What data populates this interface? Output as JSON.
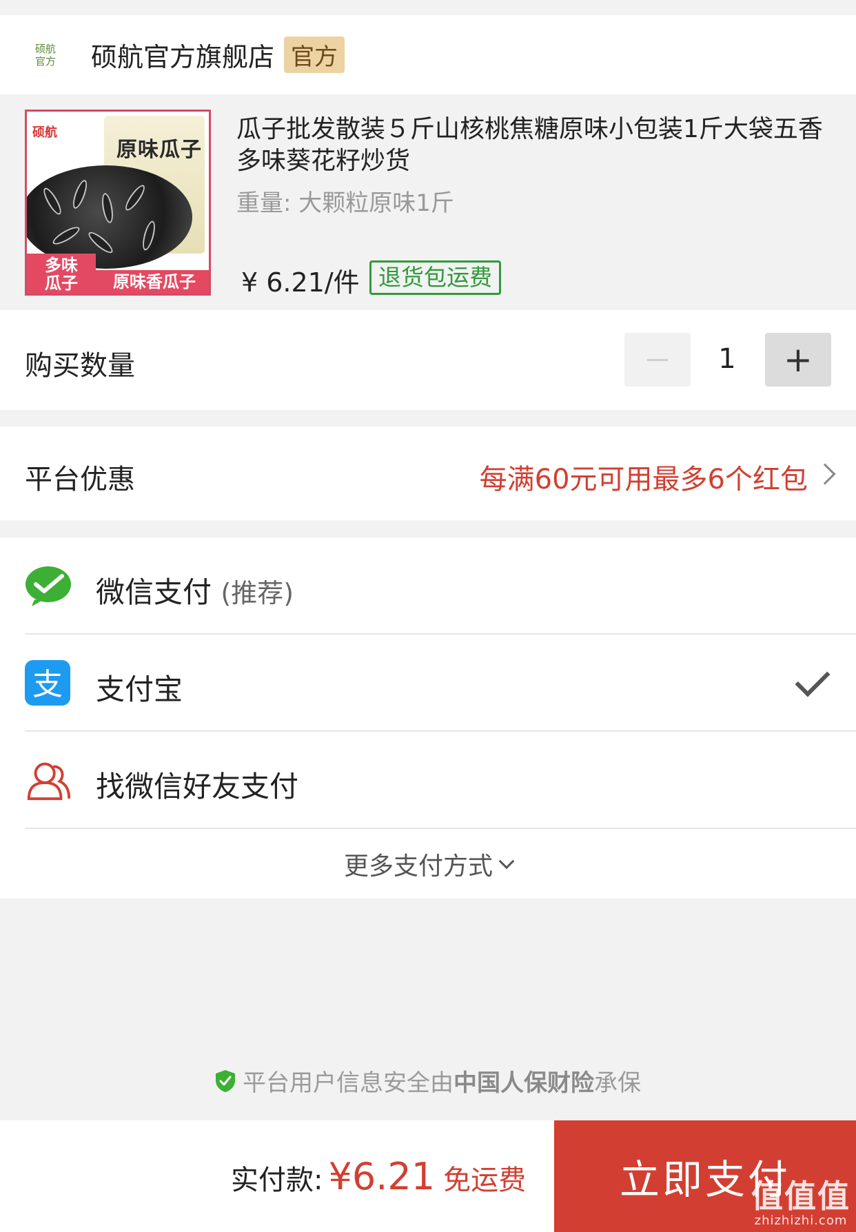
{
  "store": {
    "logo_line1": "硕航",
    "logo_line2": "官方",
    "name": "硕航官方旗舰店",
    "badge": "官方"
  },
  "product": {
    "image": {
      "brand": "硕航",
      "bag_title": "原味瓜子",
      "tag_left_line1": "多味",
      "tag_left_line2": "瓜子",
      "tag_right": "原味香瓜子"
    },
    "title": "瓜子批发散装５斤山核桃焦糖原味小包装1斤大袋五香多味葵花籽炒货",
    "spec": "重量: 大颗粒原味1斤",
    "price": "¥ 6.21/件",
    "return_badge": "退货包运费"
  },
  "quantity": {
    "label": "购买数量",
    "value": "1",
    "minus": "−",
    "plus": "+"
  },
  "promo": {
    "label": "平台优惠",
    "value": "每满60元可用最多6个红包"
  },
  "payment": {
    "methods": [
      {
        "label": "微信支付",
        "sub": "(推荐)",
        "icon": "wechat-pay-icon",
        "selected": false
      },
      {
        "label": "支付宝",
        "sub": "",
        "icon": "alipay-icon",
        "selected": true
      },
      {
        "label": "找微信好友支付",
        "sub": "",
        "icon": "friend-pay-icon",
        "selected": false
      }
    ],
    "more": "更多支付方式"
  },
  "security": {
    "prefix": "平台用户信息安全由",
    "insurer": "中国人保财险",
    "suffix": "承保"
  },
  "bottom": {
    "amount_label": "实付款:",
    "amount": "¥6.21",
    "free_shipping": "免运费",
    "pay_button": "立即支付"
  },
  "watermark": {
    "text": "值值值",
    "url": "zhizhizhi.com"
  },
  "colors": {
    "accent_red": "#d23f32",
    "green": "#2f9a3a",
    "official_badge": "#ecd3a1"
  }
}
